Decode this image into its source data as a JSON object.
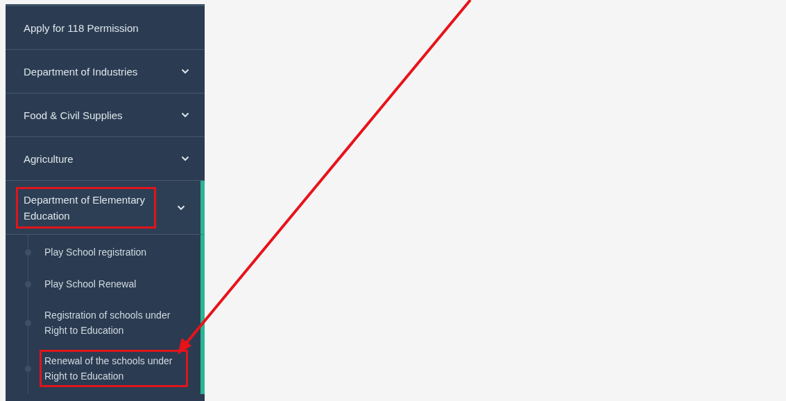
{
  "sidebar": {
    "items": [
      {
        "label": "Apply for 118 Permission",
        "expandable": false,
        "expanded": false,
        "highlighted": false
      },
      {
        "label": "Department of Industries",
        "expandable": true,
        "expanded": false,
        "highlighted": false
      },
      {
        "label": "Food & Civil Supplies",
        "expandable": true,
        "expanded": false,
        "highlighted": false
      },
      {
        "label": "Agriculture",
        "expandable": true,
        "expanded": false,
        "highlighted": false
      },
      {
        "label": "Department of Elementary Education",
        "expandable": true,
        "expanded": true,
        "highlighted": true,
        "children": [
          {
            "label": "Play School registration",
            "highlighted": false
          },
          {
            "label": "Play School Renewal",
            "highlighted": false
          },
          {
            "label": "Registration of schools under Right to Education",
            "highlighted": false
          },
          {
            "label": "Renewal of the schools under Right to Education",
            "highlighted": true
          }
        ]
      }
    ]
  }
}
